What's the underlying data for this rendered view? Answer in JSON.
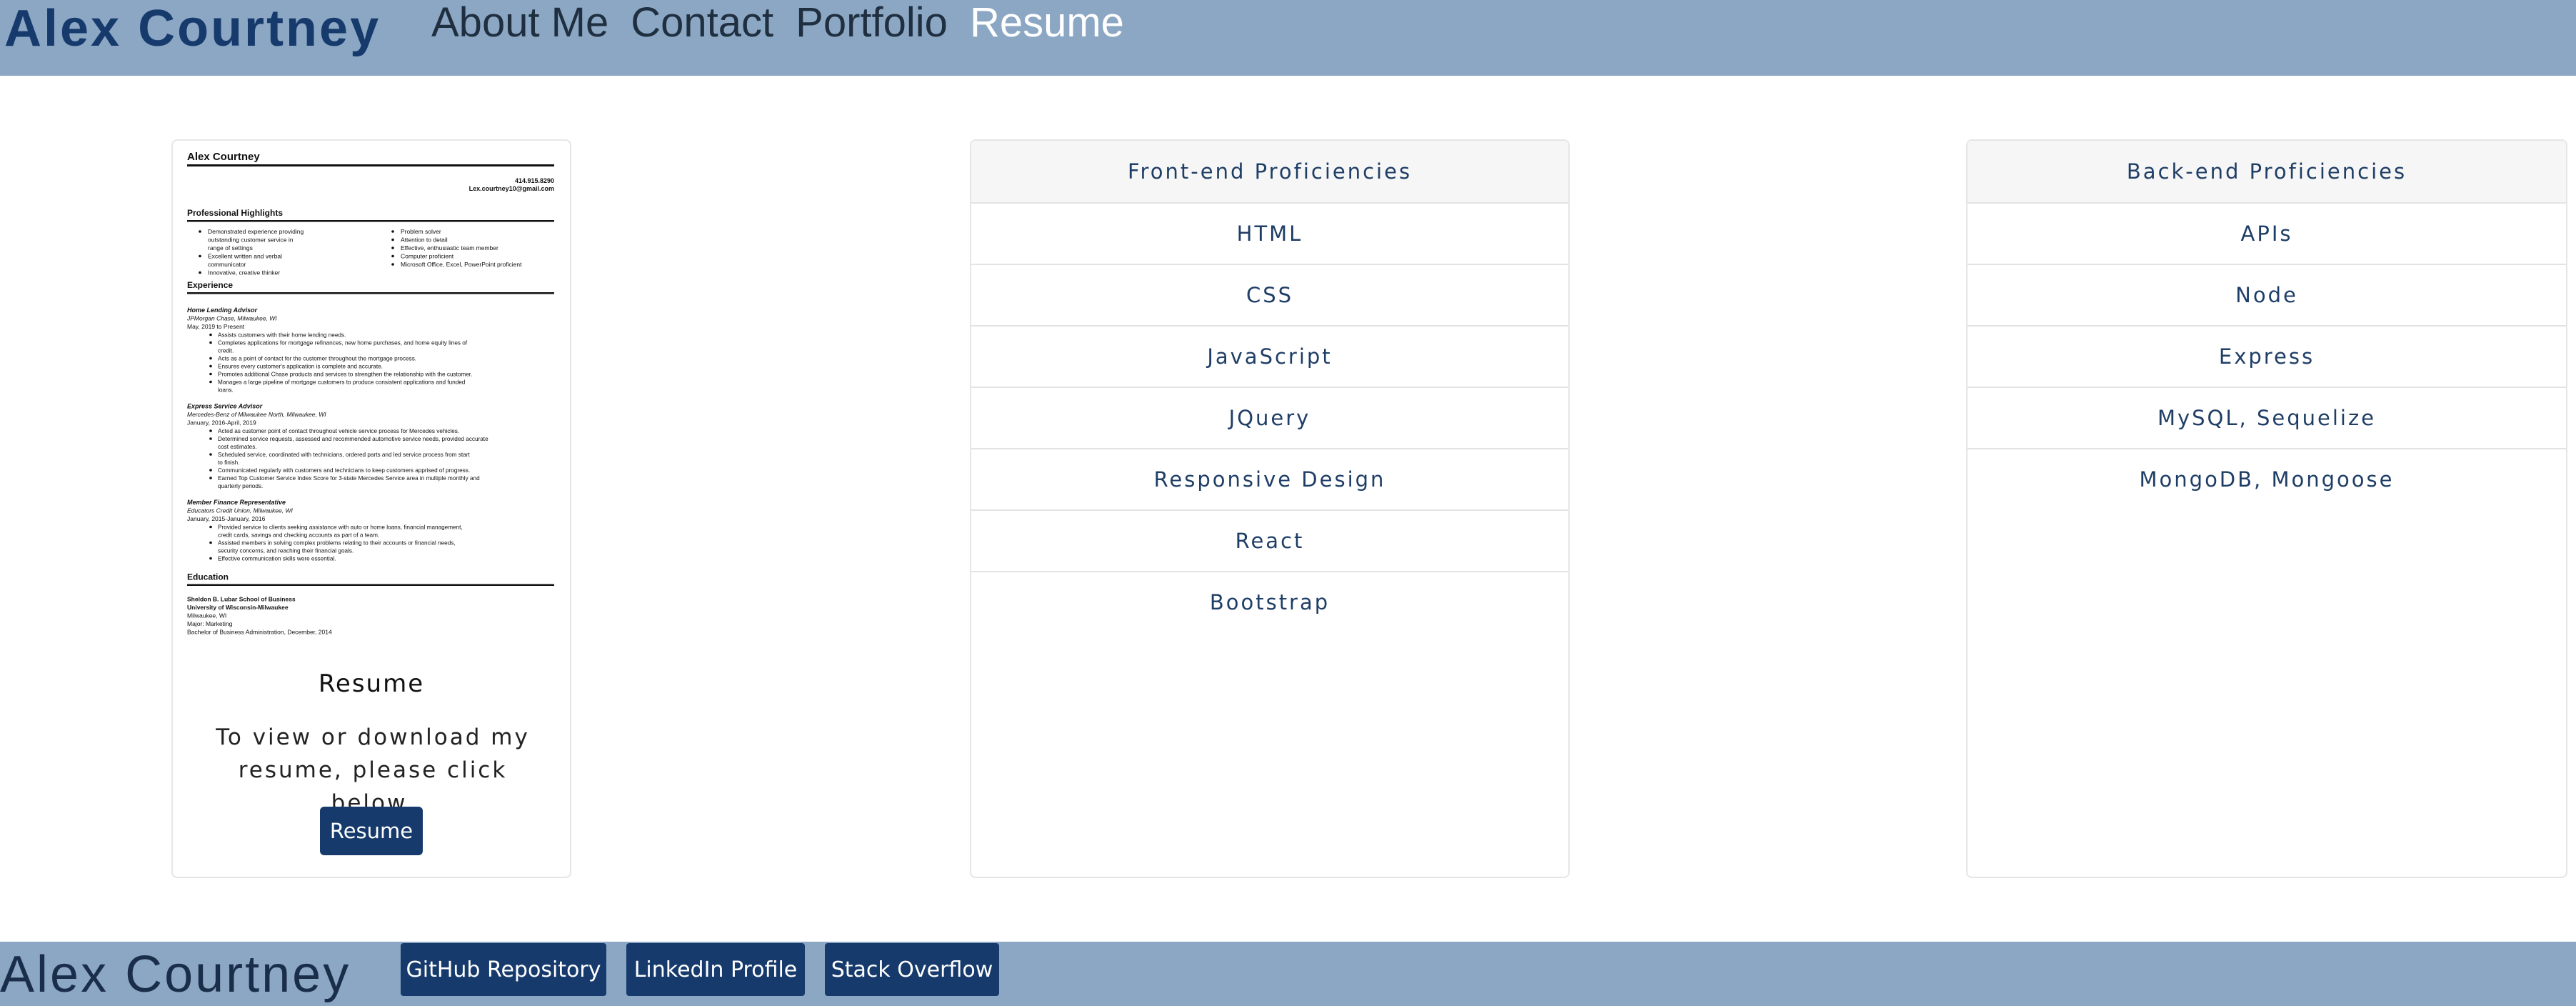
{
  "header": {
    "brand": "Alex Courtney",
    "nav": [
      "About Me",
      "Contact",
      "Portfolio",
      "Resume"
    ],
    "active_index": 3
  },
  "resume_card": {
    "doc": {
      "name": "Alex Courtney",
      "contact": [
        "414.915.8290",
        "Lex.courtney10@gmail.com"
      ],
      "highlights_title": "Professional Highlights",
      "highlights_left": [
        "Demonstrated experience providing outstanding customer service in range of settings",
        "Excellent written and verbal communicator",
        "Innovative, creative thinker"
      ],
      "highlights_right": [
        "Problem solver",
        "Attention to detail",
        "Effective, enthusiastic team member",
        "Computer proficient",
        "Microsoft Office, Excel, PowerPoint proficient"
      ],
      "experience_title": "Experience",
      "jobs": [
        {
          "title": "Home Lending Advisor",
          "company": "JPMorgan Chase, Milwaukee, WI",
          "dates": "May, 2019 to Present",
          "bullets": [
            "Assists customers with their home lending needs.",
            "Completes applications for mortgage refinances, new home purchases, and home equity lines of credit.",
            "Acts as a point of contact for the customer throughout the mortgage process.",
            "Ensures every customer's application is complete and accurate.",
            "Promotes additional Chase products and services to strengthen the relationship with the customer.",
            "Manages a large pipeline of mortgage customers to produce consistent applications and funded loans."
          ]
        },
        {
          "title": "Express Service Advisor",
          "company": "Mercedes-Benz of Milwaukee North, Milwaukee, WI",
          "dates": "January, 2016-April, 2019",
          "bullets": [
            "Acted as customer point of contact throughout vehicle service process for Mercedes vehicles.",
            "Determined service requests, assessed and recommended automotive service needs, provided accurate cost estimates.",
            "Scheduled service, coordinated with technicians, ordered parts and led service process from start to finish.",
            "Communicated regularly with customers and technicians to keep customers apprised of progress.",
            "Earned Top Customer Service Index Score for 3-state Mercedes Service area in multiple monthly and quarterly periods."
          ]
        },
        {
          "title": "Member Finance Representative",
          "company": "Educators Credit Union, Milwaukee, WI",
          "dates": "January, 2015-January, 2016",
          "bullets": [
            "Provided service to clients seeking assistance with auto or home loans, financial management, credit cards, savings and checking accounts as part of a team.",
            "Assisted members in solving complex problems relating to their accounts or financial needs, security concerns, and reaching their financial goals.",
            "Effective communication skills were essential."
          ]
        }
      ],
      "education_title": "Education",
      "education": [
        "Sheldon B. Lubar School of Business",
        "University of Wisconsin-Milwaukee",
        "Milwaukee, WI",
        "Major: Marketing",
        "Bachelor of Business Administration, December, 2014"
      ]
    },
    "title": "Resume",
    "text": "To view or download my resume, please click below.",
    "button": "Resume"
  },
  "front_end": {
    "header": "Front-end Proficiencies",
    "items": [
      "HTML",
      "CSS",
      "JavaScript",
      "JQuery",
      "Responsive Design",
      "React",
      "Bootstrap"
    ]
  },
  "back_end": {
    "header": "Back-end Proficiencies",
    "items": [
      "APIs",
      "Node",
      "Express",
      "MySQL, Sequelize",
      "MongoDB, Mongoose"
    ]
  },
  "footer": {
    "name": "Alex Courtney",
    "buttons": [
      "GitHub Repository",
      "LinkedIn Profile",
      "Stack Overflow"
    ]
  },
  "colors": {
    "bar": "#8ba7c4",
    "brand": "#163a6c",
    "button": "#163a6c",
    "list_text": "#1f3e66"
  }
}
